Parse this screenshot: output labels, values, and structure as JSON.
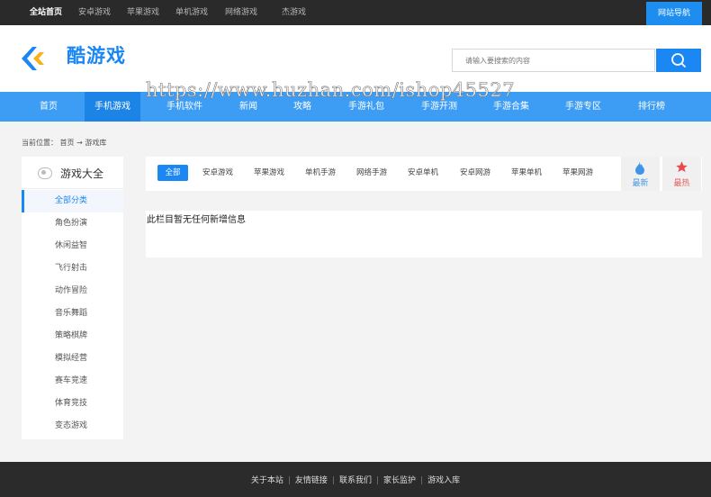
{
  "topbar": {
    "links": [
      "全站首页",
      "安卓游戏",
      "苹果游戏",
      "单机游戏",
      "网络游戏",
      "杰游戏"
    ],
    "nav_button": "网站导航"
  },
  "header": {
    "logo_text": "酷游戏",
    "search_placeholder": "请输入要搜索的内容",
    "search_icon": "search-icon"
  },
  "mainnav": {
    "items": [
      "首页",
      "手机游戏",
      "手机软件",
      "新闻",
      "攻略",
      "手游礼包",
      "手游开测",
      "手游合集",
      "手游专区",
      "排行榜"
    ],
    "active_index": 1
  },
  "watermark": "https://www.huzhan.com/ishop45527",
  "breadcrumb": {
    "label": "当前位置：",
    "path": "首页 → 游戏库"
  },
  "sidebar": {
    "title": "游戏大全",
    "items": [
      "全部分类",
      "角色扮演",
      "休闲益智",
      "飞行射击",
      "动作冒险",
      "音乐舞蹈",
      "策略棋牌",
      "模拟经营",
      "赛车竞速",
      "体育竞技",
      "变态游戏"
    ],
    "active_index": 0
  },
  "filters": {
    "items": [
      "全部",
      "安卓游戏",
      "苹果游戏",
      "单机手游",
      "网络手游",
      "安卓单机",
      "安卓网游",
      "苹果单机",
      "苹果网游"
    ],
    "active_index": 0
  },
  "sort": {
    "newest": "最新",
    "hottest": "最热"
  },
  "content": {
    "empty_message": "此栏目暂无任何新增信息"
  },
  "footer": {
    "links": [
      "关于本站",
      "友情链接",
      "联系我们",
      "家长监护",
      "游戏入库"
    ]
  },
  "colors": {
    "brand_blue": "#1b87f3",
    "nav_blue": "#3d9df4",
    "dark_bar": "#2a2a2a"
  }
}
